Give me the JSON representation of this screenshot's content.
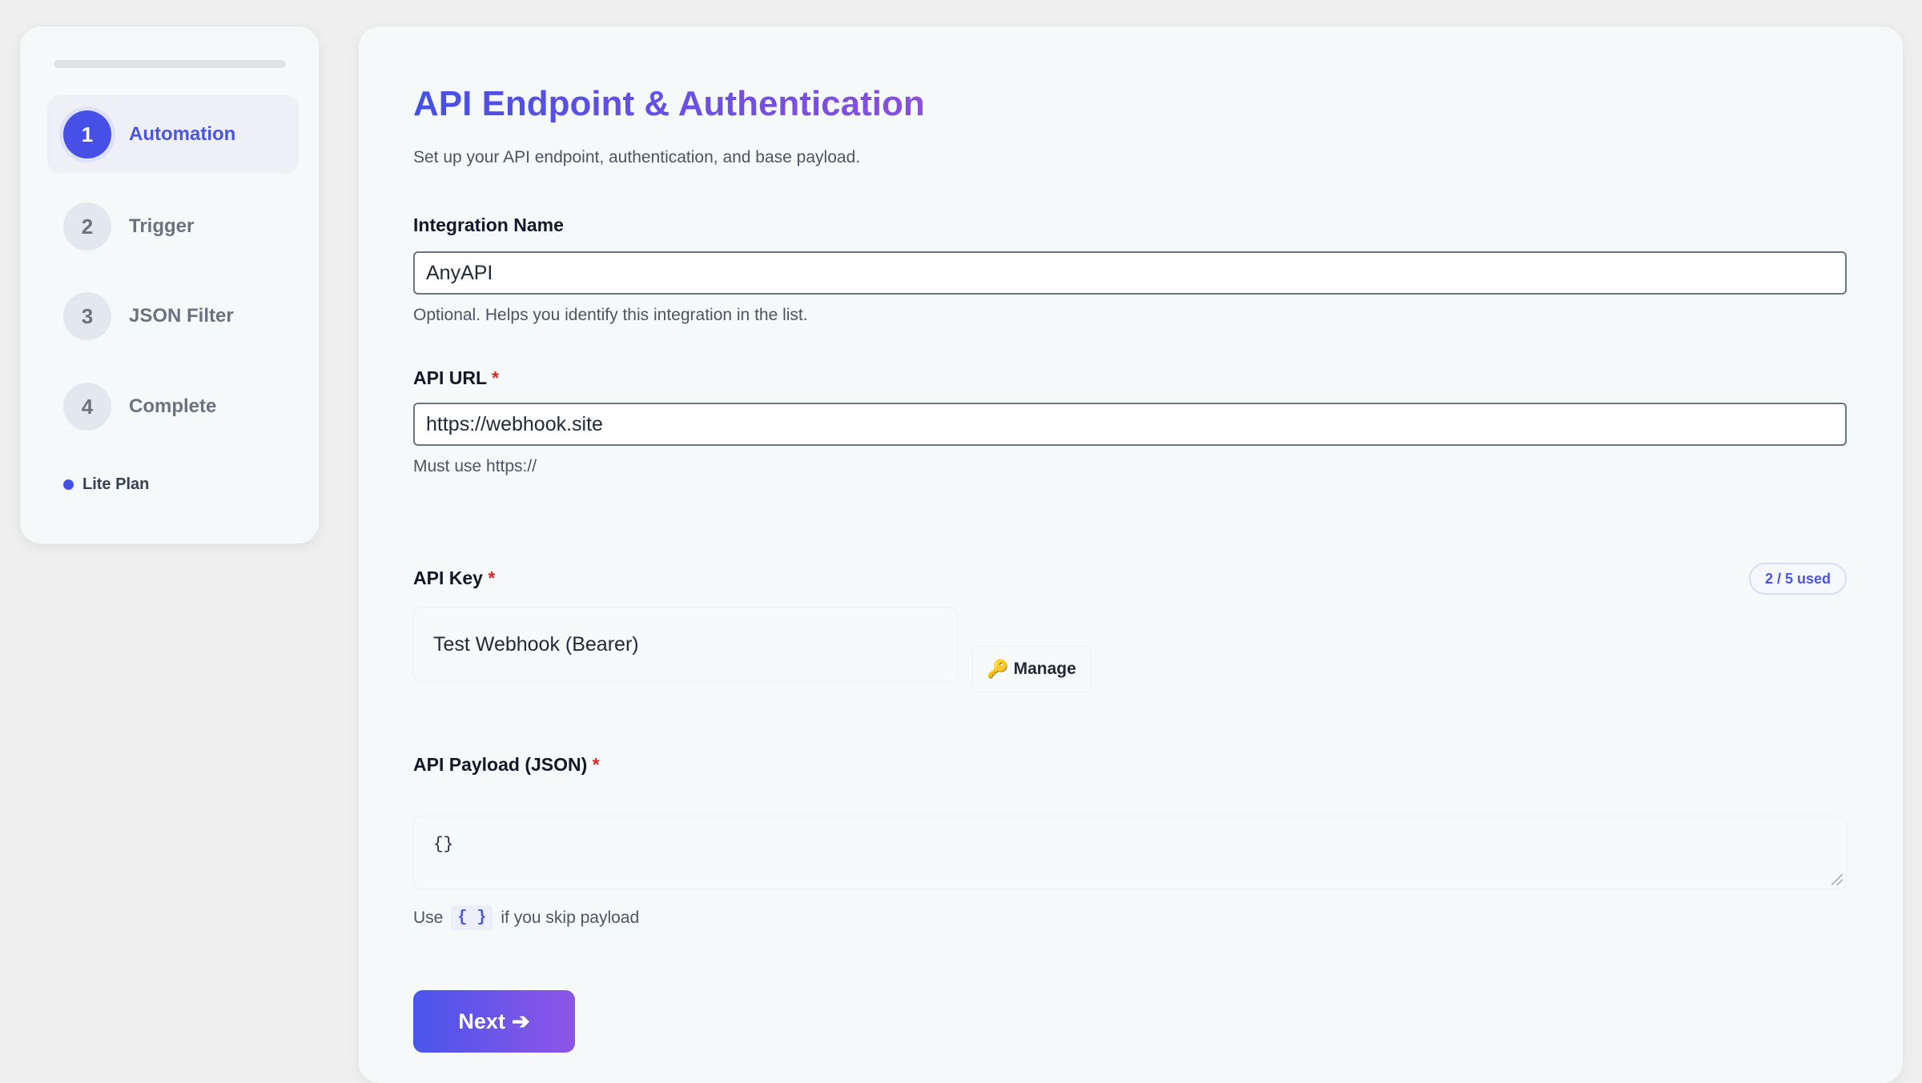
{
  "sidebar": {
    "steps": [
      {
        "num": "1",
        "label": "Automation"
      },
      {
        "num": "2",
        "label": "Trigger"
      },
      {
        "num": "3",
        "label": "JSON Filter"
      },
      {
        "num": "4",
        "label": "Complete"
      }
    ],
    "active_step": 1,
    "plan": "Lite Plan"
  },
  "main": {
    "title": "API Endpoint & Authentication",
    "subtitle": "Set up your API endpoint, authentication, and base payload.",
    "integration_name": {
      "label": "Integration Name",
      "value": "AnyAPI",
      "help": "Optional. Helps you identify this integration in the list."
    },
    "api_url": {
      "label": "API URL",
      "required": "*",
      "value": "https://webhook.site",
      "help": "Must use https://"
    },
    "api_key": {
      "label": "API Key",
      "required": "*",
      "usage_badge": "2 / 5 used",
      "selected": "Test Webhook (Bearer)",
      "manage_label": "Manage",
      "manage_icon": "🔑"
    },
    "payload": {
      "label": "API Payload (JSON)",
      "required": "*",
      "value": "{}",
      "help_prefix": "Use",
      "help_code": "{ }",
      "help_suffix": "if you skip payload"
    },
    "next_label": "Next",
    "next_arrow": "➔"
  },
  "colors": {
    "accent": "#4650e6",
    "accent_end": "#8e55e6",
    "required": "#dc2626"
  }
}
